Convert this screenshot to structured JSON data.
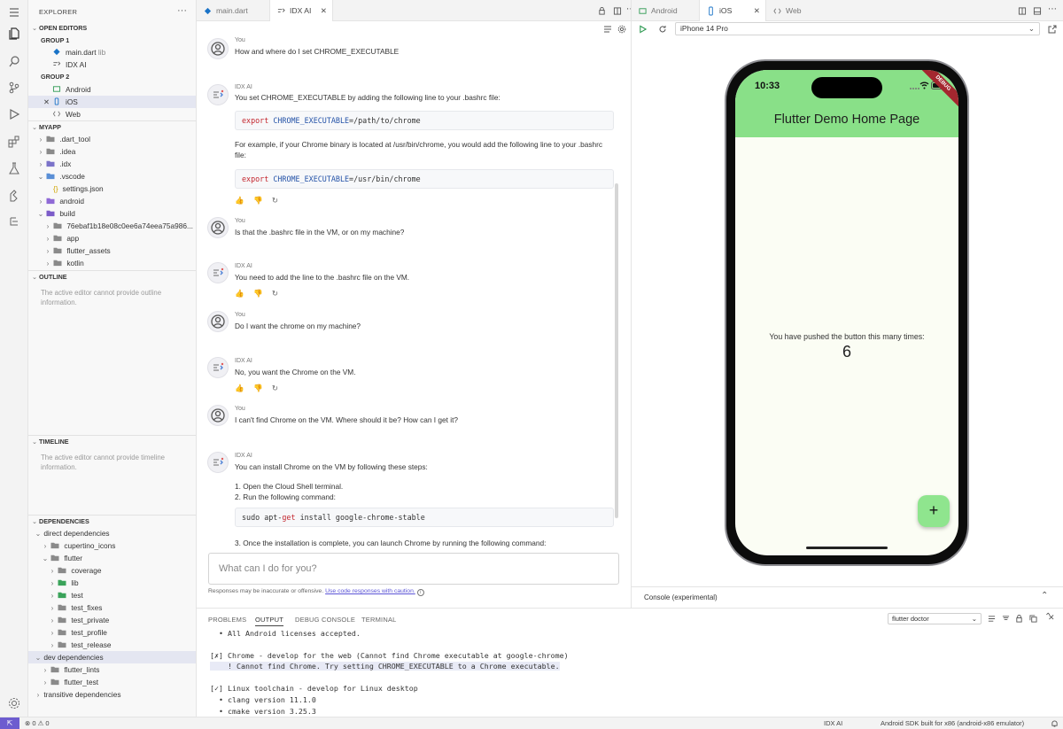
{
  "explorer": {
    "title": "EXPLORER",
    "sections": {
      "open_editors": "OPEN EDITORS",
      "group1": "GROUP 1",
      "group2": "GROUP 2",
      "myapp": "MYAPP",
      "outline": "OUTLINE",
      "timeline": "TIMELINE",
      "dependencies": "DEPENDENCIES"
    },
    "open_editors": {
      "group1": [
        {
          "label": "main.dart",
          "hint": "lib"
        },
        {
          "label": "IDX AI",
          "hint": ""
        }
      ],
      "group2": [
        {
          "label": "Android"
        },
        {
          "label": "iOS"
        },
        {
          "label": "Web"
        }
      ]
    },
    "tree": [
      ".dart_tool",
      ".idea",
      ".idx",
      ".vscode",
      "settings.json",
      "android",
      "build",
      "76ebaf1b18e08c0ee6a74eea75a986...",
      "app",
      "flutter_assets",
      "kotlin"
    ],
    "outline_note": "The active editor cannot provide outline information.",
    "timeline_note": "The active editor cannot provide timeline information.",
    "dependencies": [
      "direct dependencies",
      "cupertino_icons",
      "flutter",
      "coverage",
      "lib",
      "test",
      "test_fixes",
      "test_private",
      "test_profile",
      "test_release",
      "dev dependencies",
      "flutter_lints",
      "flutter_test",
      "transitive dependencies"
    ]
  },
  "editor_tabs": [
    "main.dart",
    "IDX AI"
  ],
  "chat": {
    "messages": [
      {
        "author": "You",
        "text": "How and where do I set CHROME_EXECUTABLE"
      },
      {
        "author": "IDX AI",
        "text": "You set CHROME_EXECUTABLE by adding the following line to your .bashrc file:",
        "code": [
          "export",
          "CHROME_EXECUTABLE",
          "=/path/to/chrome"
        ],
        "text2": "For example, if your Chrome binary is located at /usr/bin/chrome, you would add the following line to your .bashrc file:",
        "code2": [
          "export",
          "CHROME_EXECUTABLE",
          "=/usr/bin/chrome"
        ]
      },
      {
        "author": "You",
        "text": "Is that the .bashrc file in the VM, or on my machine?"
      },
      {
        "author": "IDX AI",
        "text": "You need to add the line to the .bashrc file on the VM."
      },
      {
        "author": "You",
        "text": "Do I want the chrome on my machine?"
      },
      {
        "author": "IDX AI",
        "text": "No, you want the Chrome on the VM."
      },
      {
        "author": "You",
        "text": "I can't find Chrome on the VM. Where should it be? How can I get it?"
      },
      {
        "author": "IDX AI",
        "text": "You can install Chrome on the VM by following these steps:",
        "step1": "1. Open the Cloud Shell terminal.",
        "step2": "2. Run the following command:",
        "code": [
          "sudo apt-",
          "get",
          " install google-chrome-stable"
        ],
        "step3": "3. Once the installation is complete, you can launch Chrome by running the following command:"
      }
    ],
    "feedback": "👍 👎 ↻",
    "input_placeholder": "What can I do for you?",
    "disclaimer": "Responses may be inaccurate or offensive.",
    "disclaimer_link": "Use code responses with caution."
  },
  "preview": {
    "tabs": [
      "Android",
      "iOS",
      "Web"
    ],
    "device": "iPhone 14 Pro",
    "time": "10:33",
    "debug": "DEBUG",
    "app_title": "Flutter Demo Home Page",
    "counter_label": "You have pushed the button this many times:",
    "counter_value": "6",
    "fab": "+",
    "console": "Console (experimental)"
  },
  "panel": {
    "tabs": [
      "PROBLEMS",
      "OUTPUT",
      "DEBUG CONSOLE",
      "TERMINAL"
    ],
    "output_source": "flutter doctor",
    "lines": [
      "  • All Android licenses accepted.",
      "[✗] Chrome - develop for the web (Cannot find Chrome executable at google-chrome)",
      "    ! Cannot find Chrome. Try setting CHROME_EXECUTABLE to a Chrome executable.",
      "[✓] Linux toolchain - develop for Linux desktop",
      "  • clang version 11.1.0",
      "  • cmake version 3.25.3"
    ]
  },
  "status": {
    "problems": "⊗ 0 ⚠ 0",
    "idx": "IDX AI",
    "device": "Android SDK built for x86 (android-x86 emulator)"
  }
}
